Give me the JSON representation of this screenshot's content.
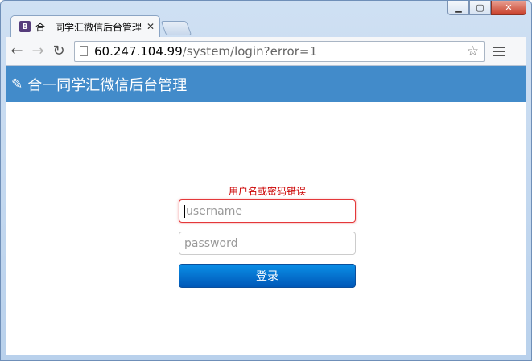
{
  "browser": {
    "tab_title": "合一同学汇微信后台管理",
    "tab_favicon": "B",
    "url_host": "60.247.104.99",
    "url_path": "/system/login?error=1"
  },
  "app": {
    "title": "合一同学汇微信后台管理",
    "brand_color": "#428bca"
  },
  "login": {
    "error_message": "用户名或密码错误",
    "username_placeholder": "username",
    "password_placeholder": "password",
    "submit_label": "登录"
  }
}
